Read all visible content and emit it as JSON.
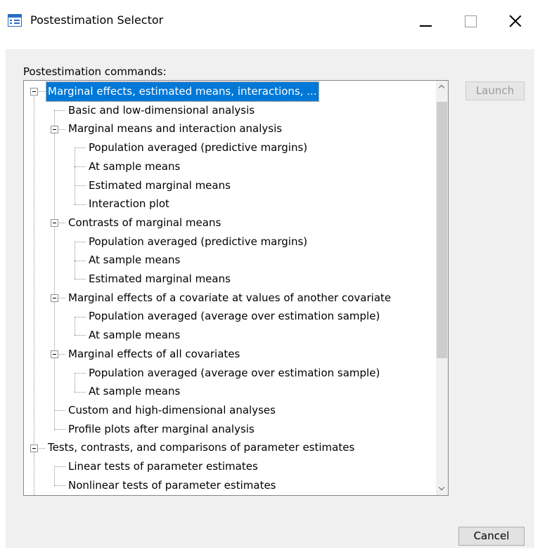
{
  "window": {
    "title": "Postestimation Selector",
    "icon": "dialog-window-icon"
  },
  "dialog": {
    "tree_label": "Postestimation commands:",
    "launch_label": "Launch",
    "cancel_label": "Cancel"
  },
  "tree": {
    "items": [
      {
        "label": "Marginal effects, estimated means, interactions, ...",
        "level": 0,
        "expanded": true,
        "selected": true
      },
      {
        "label": "Basic and low-dimensional analysis",
        "level": 1
      },
      {
        "label": "Marginal means and interaction analysis",
        "level": 1,
        "expanded": true
      },
      {
        "label": "Population averaged (predictive margins)",
        "level": 2
      },
      {
        "label": "At sample means",
        "level": 2
      },
      {
        "label": "Estimated marginal means",
        "level": 2
      },
      {
        "label": "Interaction plot",
        "level": 2
      },
      {
        "label": "Contrasts of marginal means",
        "level": 1,
        "expanded": true
      },
      {
        "label": "Population averaged (predictive margins)",
        "level": 2
      },
      {
        "label": "At sample means",
        "level": 2
      },
      {
        "label": "Estimated marginal means",
        "level": 2
      },
      {
        "label": "Marginal effects of a covariate at values of another covariate",
        "level": 1,
        "expanded": true
      },
      {
        "label": "Population averaged (average over estimation sample)",
        "level": 2
      },
      {
        "label": "At sample means",
        "level": 2
      },
      {
        "label": "Marginal effects of all covariates",
        "level": 1,
        "expanded": true
      },
      {
        "label": "Population averaged (average over estimation sample)",
        "level": 2
      },
      {
        "label": "At sample means",
        "level": 2
      },
      {
        "label": "Custom and high-dimensional analyses",
        "level": 1
      },
      {
        "label": "Profile plots after marginal analysis",
        "level": 1
      },
      {
        "label": "Tests, contrasts, and comparisons of parameter estimates",
        "level": 0,
        "expanded": true
      },
      {
        "label": "Linear tests of parameter estimates",
        "level": 1
      },
      {
        "label": "Nonlinear tests of parameter estimates",
        "level": 1
      }
    ]
  },
  "colors": {
    "selection": "#0078d7",
    "scroll_thumb": "#cdcdcd"
  }
}
